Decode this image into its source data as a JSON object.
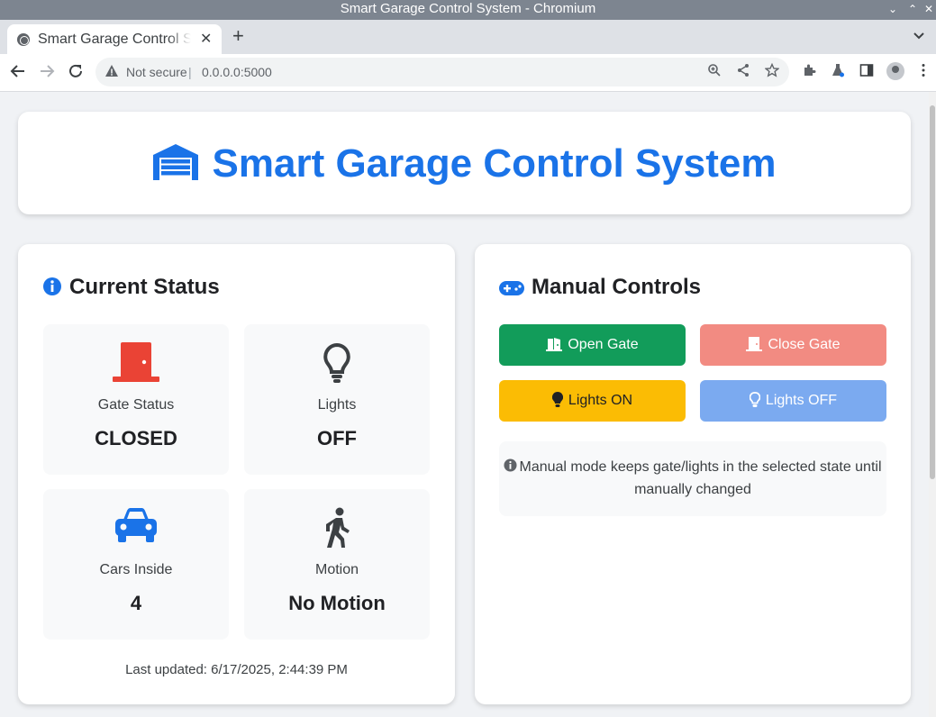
{
  "window": {
    "title": "Smart Garage Control System - Chromium"
  },
  "tab": {
    "title": "Smart Garage Control System",
    "close": "✕"
  },
  "toolbar": {
    "security": "Not secure",
    "url": "0.0.0.0:5000"
  },
  "header": {
    "title": "Smart Garage Control System"
  },
  "status": {
    "title": "Current Status",
    "gate": {
      "label": "Gate Status",
      "value": "CLOSED"
    },
    "lights": {
      "label": "Lights",
      "value": "OFF"
    },
    "cars": {
      "label": "Cars Inside",
      "value": "4"
    },
    "motion": {
      "label": "Motion",
      "value": "No Motion"
    },
    "last_updated": "Last updated: 6/17/2025, 2:44:39 PM"
  },
  "controls": {
    "title": "Manual Controls",
    "open_gate": "Open Gate",
    "close_gate": "Close Gate",
    "lights_on": "Lights ON",
    "lights_off": "Lights OFF",
    "note": "Manual mode keeps gate/lights in the selected state until manually changed"
  },
  "colors": {
    "accent": "#1a73e8",
    "gate_closed": "#ea4335",
    "open_button": "#129c5a",
    "close_button": "#f28b82",
    "lights_on_button": "#fbbc04",
    "lights_off_button": "#7baaf0"
  },
  "icons": {
    "header": "garage-icon",
    "status": "info-circle-icon",
    "controls": "gamepad-icon",
    "gate": "door-closed-icon",
    "lights": "lightbulb-icon",
    "cars": "car-icon",
    "motion": "walking-person-icon"
  }
}
